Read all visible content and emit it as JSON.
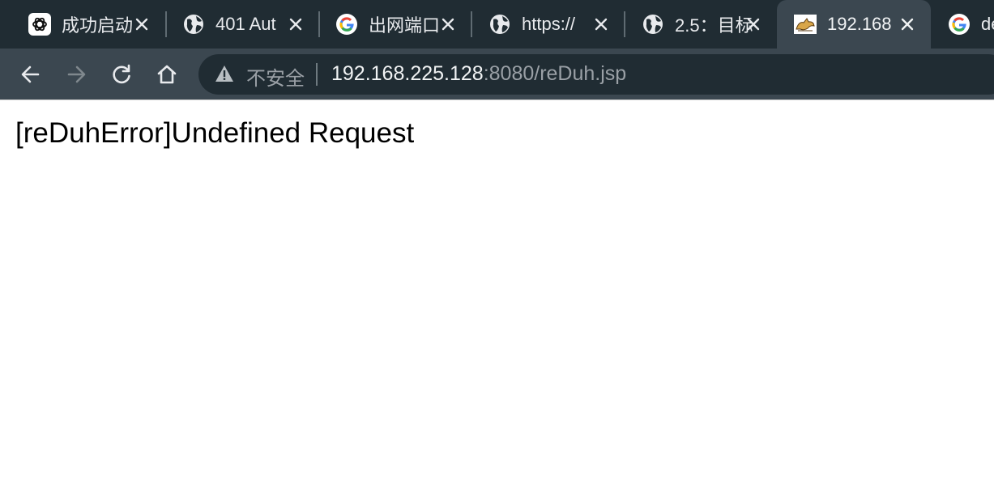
{
  "tabs": [
    {
      "title": "成功启动",
      "favicon": "chatgpt-icon",
      "active": false
    },
    {
      "title": "401 Aut",
      "favicon": "globe-icon",
      "active": false
    },
    {
      "title": "出网端口",
      "favicon": "google-icon",
      "active": false
    },
    {
      "title": "https://",
      "favicon": "globe-icon",
      "active": false
    },
    {
      "title": "2.5：目标",
      "favicon": "globe-icon",
      "active": false
    },
    {
      "title": "192.168",
      "favicon": "tomcat-icon",
      "active": true
    },
    {
      "title": "de",
      "favicon": "google-icon",
      "active": false
    }
  ],
  "toolbar": {
    "back_icon": "back-arrow-icon",
    "forward_icon": "forward-arrow-icon",
    "reload_icon": "reload-icon",
    "home_icon": "home-icon"
  },
  "omnibox": {
    "security_icon": "warning-triangle-icon",
    "security_label": "不安全",
    "url_host": "192.168.225.128",
    "url_path": ":8080/reDuh.jsp"
  },
  "page": {
    "message": "[reDuhError]Undefined Request"
  },
  "colors": {
    "tabstrip_bg": "#202c33",
    "toolbar_bg": "#3b4750",
    "omnibox_bg": "#202c33",
    "text_light": "#e8eaed",
    "text_dim": "#9aa0a6"
  }
}
